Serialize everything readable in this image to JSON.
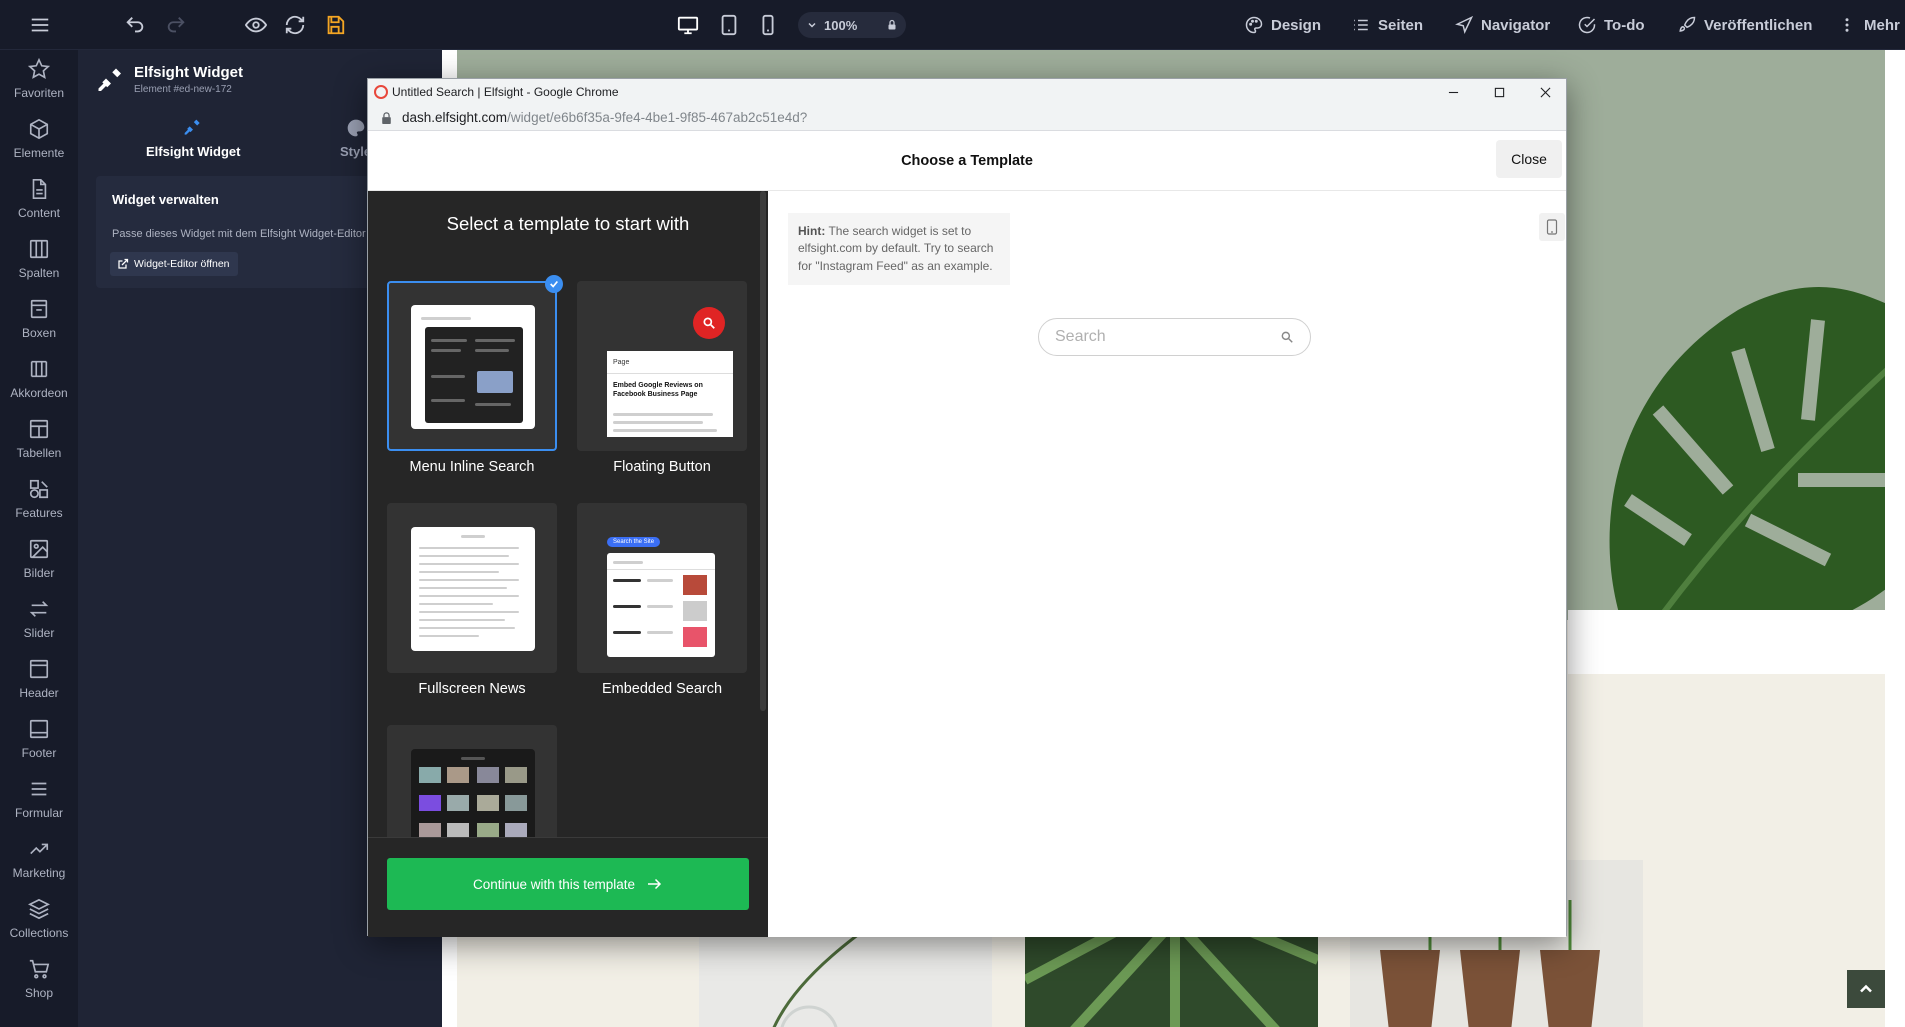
{
  "topbar": {
    "zoom": "100%",
    "nav": {
      "design": "Design",
      "seiten": "Seiten",
      "navigator": "Navigator",
      "todo": "To-do",
      "publish": "Veröffentlichen",
      "mehr": "Mehr"
    },
    "icons": [
      "menu-icon",
      "undo-icon",
      "redo-icon",
      "eye-icon",
      "refresh-icon",
      "save-icon",
      "desktop-icon",
      "tablet-icon",
      "mobile-icon",
      "lock-icon"
    ]
  },
  "rail": {
    "items": [
      {
        "label": "Favoriten",
        "icon": "star-icon"
      },
      {
        "label": "Elemente",
        "icon": "cube-icon"
      },
      {
        "label": "Content",
        "icon": "document-icon"
      },
      {
        "label": "Spalten",
        "icon": "columns-icon"
      },
      {
        "label": "Boxen",
        "icon": "box-icon"
      },
      {
        "label": "Akkordeon",
        "icon": "accordion-icon"
      },
      {
        "label": "Tabellen",
        "icon": "table-icon"
      },
      {
        "label": "Features",
        "icon": "features-icon"
      },
      {
        "label": "Bilder",
        "icon": "image-icon"
      },
      {
        "label": "Slider",
        "icon": "slider-icon"
      },
      {
        "label": "Header",
        "icon": "header-icon"
      },
      {
        "label": "Footer",
        "icon": "footer-icon"
      },
      {
        "label": "Formular",
        "icon": "form-icon"
      },
      {
        "label": "Marketing",
        "icon": "trend-icon"
      },
      {
        "label": "Collections",
        "icon": "layers-icon"
      },
      {
        "label": "Shop",
        "icon": "cart-icon"
      }
    ]
  },
  "panel": {
    "title": "Elfsight Widget",
    "subtitle": "Element #ed-new-172",
    "tabs": {
      "widget": "Elfsight Widget",
      "style": "Style"
    },
    "box": {
      "title": "Widget verwalten",
      "text": "Passe dieses Widget mit dem Elfsight Widget-Editor",
      "button": "Widget-Editor öffnen"
    }
  },
  "chrome": {
    "window_title": "Untitled Search | Elfsight - Google Chrome",
    "url_host": "dash.elfsight.com",
    "url_path": "/widget/e6b6f35a-9fe4-4be1-9f85-467ab2c51e4d?"
  },
  "modal": {
    "title": "Choose a Template",
    "close": "Close",
    "heading": "Select a template to start with",
    "templates": [
      {
        "label": "Menu Inline Search",
        "selected": true
      },
      {
        "label": "Floating Button",
        "selected": false
      },
      {
        "label": "Fullscreen News",
        "selected": false
      },
      {
        "label": "Embedded Search",
        "selected": false
      },
      {
        "label": "",
        "selected": false
      }
    ],
    "continue": "Continue with this template",
    "thumb_texts": {
      "floating_title": "Embed Google Reviews on Facebook Business Page",
      "floating_query": "Page",
      "embedded_badge": "Search the Site"
    }
  },
  "preview": {
    "hint_label": "Hint:",
    "hint_text": " The search widget is set to elfsight.com by default. Try to search for \"Instagram Feed\" as an example.",
    "search_placeholder": "Search"
  },
  "colors": {
    "accent": "#3b8ef0",
    "continue": "#1db954",
    "save": "#f5a623",
    "floating_button": "#e02424"
  }
}
